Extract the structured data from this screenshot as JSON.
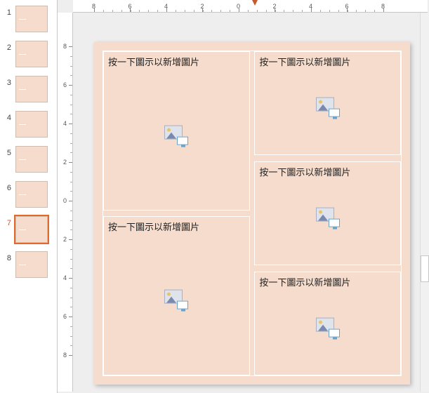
{
  "thumbnails": {
    "count": 8,
    "selected_index": 7,
    "numbers": [
      "1",
      "2",
      "3",
      "4",
      "5",
      "6",
      "7",
      "8"
    ]
  },
  "ruler": {
    "h_labels": [
      "8",
      "6",
      "4",
      "2",
      "0",
      "2",
      "4",
      "6",
      "8"
    ],
    "v_labels": [
      "8",
      "6",
      "4",
      "2",
      "0",
      "2",
      "4",
      "6",
      "8"
    ]
  },
  "slide": {
    "bg": "#f5dccd",
    "placeholder_prompt": "按一下圖示以新增圖片",
    "placeholders": {
      "p1": {
        "prompt_key": "slide.placeholder_prompt"
      },
      "p2": {
        "prompt_key": "slide.placeholder_prompt"
      },
      "p3": {
        "prompt_key": "slide.placeholder_prompt"
      },
      "p4": {
        "prompt_key": "slide.placeholder_prompt"
      },
      "p5": {
        "prompt_key": "slide.placeholder_prompt"
      }
    }
  },
  "colors": {
    "accent": "#e06a2b",
    "slide_bg": "#f5dccd"
  }
}
